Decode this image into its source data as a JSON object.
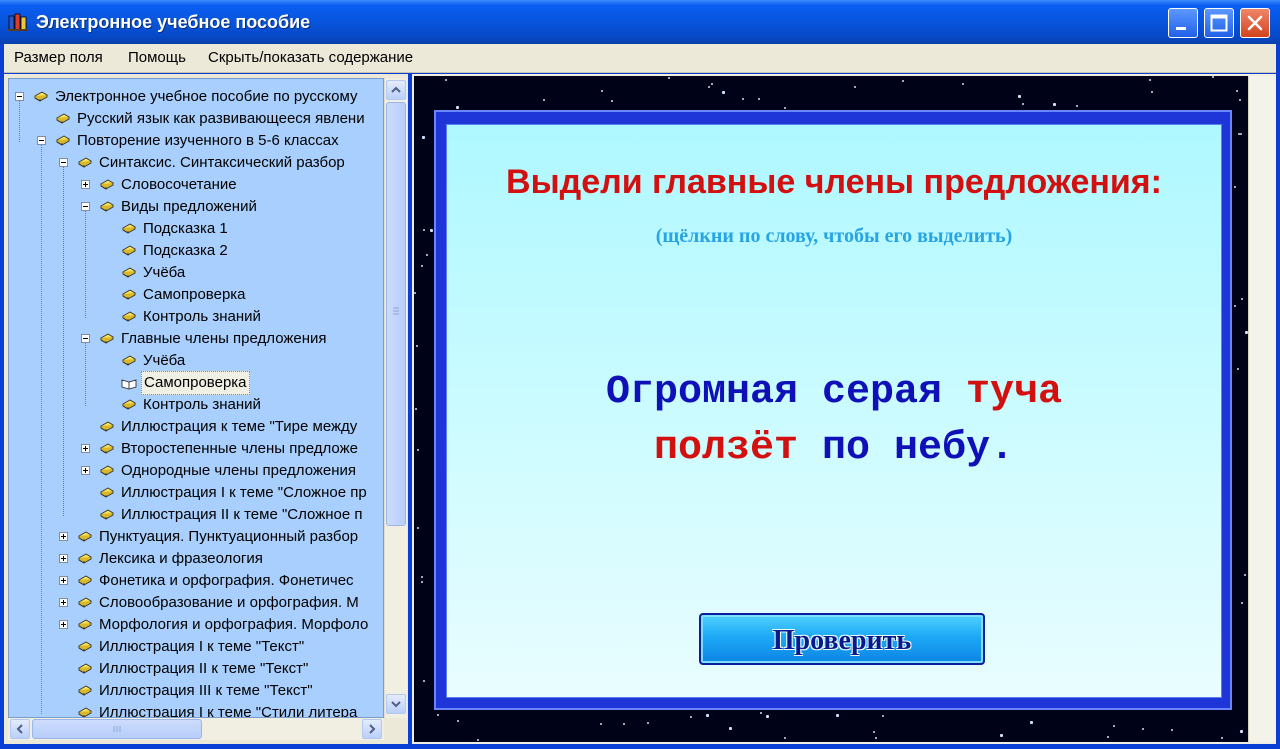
{
  "window": {
    "title": "Электронное учебное пособие",
    "title_bar_color": "#0a5ef2",
    "close_color": "#d2431d"
  },
  "menu": {
    "items": [
      "Размер поля",
      "Помощь",
      "Скрыть/показать содержание"
    ]
  },
  "tree": {
    "background": "#a8cffd",
    "items": [
      {
        "label": "Электронное учебное пособие по русскому",
        "expander": "minus",
        "icon": "closed-book-icon"
      },
      {
        "label": "Русский язык как развивающееся явлени",
        "expander": "none",
        "icon": "closed-book-icon"
      },
      {
        "label": "Повторение изученного в 5-6 классах",
        "expander": "minus",
        "icon": "closed-book-icon"
      },
      {
        "label": "Синтаксис. Синтаксический разбор",
        "expander": "minus",
        "icon": "closed-book-icon"
      },
      {
        "label": "Словосочетание",
        "expander": "plus",
        "icon": "closed-book-icon"
      },
      {
        "label": "Виды предложений",
        "expander": "minus",
        "icon": "closed-book-icon"
      },
      {
        "label": "Подсказка 1",
        "expander": "none",
        "icon": "closed-book-icon"
      },
      {
        "label": "Подсказка 2",
        "expander": "none",
        "icon": "closed-book-icon"
      },
      {
        "label": "Учёба",
        "expander": "none",
        "icon": "closed-book-icon"
      },
      {
        "label": "Самопроверка",
        "expander": "none",
        "icon": "closed-book-icon"
      },
      {
        "label": "Контроль знаний",
        "expander": "none",
        "icon": "closed-book-icon"
      },
      {
        "label": "Главные члены предложения",
        "expander": "minus",
        "icon": "closed-book-icon"
      },
      {
        "label": "Учёба",
        "expander": "none",
        "icon": "closed-book-icon"
      },
      {
        "label": "Самопроверка",
        "expander": "none",
        "icon": "open-book-icon",
        "selected": true
      },
      {
        "label": "Контроль знаний",
        "expander": "none",
        "icon": "closed-book-icon"
      },
      {
        "label": "Иллюстрация к теме \"Тире между",
        "expander": "none",
        "icon": "closed-book-icon"
      },
      {
        "label": "Второстепенные члены предложе",
        "expander": "plus",
        "icon": "closed-book-icon"
      },
      {
        "label": "Однородные члены предложения",
        "expander": "plus",
        "icon": "closed-book-icon"
      },
      {
        "label": "Иллюстрация I к теме \"Сложное пр",
        "expander": "none",
        "icon": "closed-book-icon"
      },
      {
        "label": "Иллюстрация II к теме \"Сложное п",
        "expander": "none",
        "icon": "closed-book-icon"
      },
      {
        "label": "Пунктуация. Пунктуационный разбор",
        "expander": "plus",
        "icon": "closed-book-icon"
      },
      {
        "label": "Лексика и фразеология",
        "expander": "plus",
        "icon": "closed-book-icon"
      },
      {
        "label": "Фонетика и орфография. Фонетичес",
        "expander": "plus",
        "icon": "closed-book-icon"
      },
      {
        "label": "Словообразование и орфография. М",
        "expander": "plus",
        "icon": "closed-book-icon"
      },
      {
        "label": "Морфология и орфография. Морфоло",
        "expander": "plus",
        "icon": "closed-book-icon"
      },
      {
        "label": "Иллюстрация I к теме \"Текст\"",
        "expander": "none",
        "icon": "closed-book-icon"
      },
      {
        "label": "Иллюстрация II к теме \"Текст\"",
        "expander": "none",
        "icon": "closed-book-icon"
      },
      {
        "label": "Иллюстрация III к теме \"Текст\"",
        "expander": "none",
        "icon": "closed-book-icon"
      },
      {
        "label": "Иллюстрация I к теме \"Стили литера",
        "expander": "none",
        "icon": "closed-book-icon"
      }
    ]
  },
  "exercise": {
    "title": "Выдели главные члены предложения:",
    "hint": "(щёлкни по слову, чтобы его выделить)",
    "lines": [
      [
        {
          "text": "Огромная",
          "selected": false
        },
        {
          "text": "серая",
          "selected": false
        },
        {
          "text": "туча",
          "selected": true
        }
      ],
      [
        {
          "text": "ползёт",
          "selected": true
        },
        {
          "text": "по",
          "selected": false
        },
        {
          "text": "небу.",
          "selected": false
        }
      ]
    ],
    "check_label": "Проверить",
    "colors": {
      "title": "#d31010",
      "hint": "#26a4e6",
      "word": "#1010b8",
      "selected_word": "#d31010"
    }
  }
}
